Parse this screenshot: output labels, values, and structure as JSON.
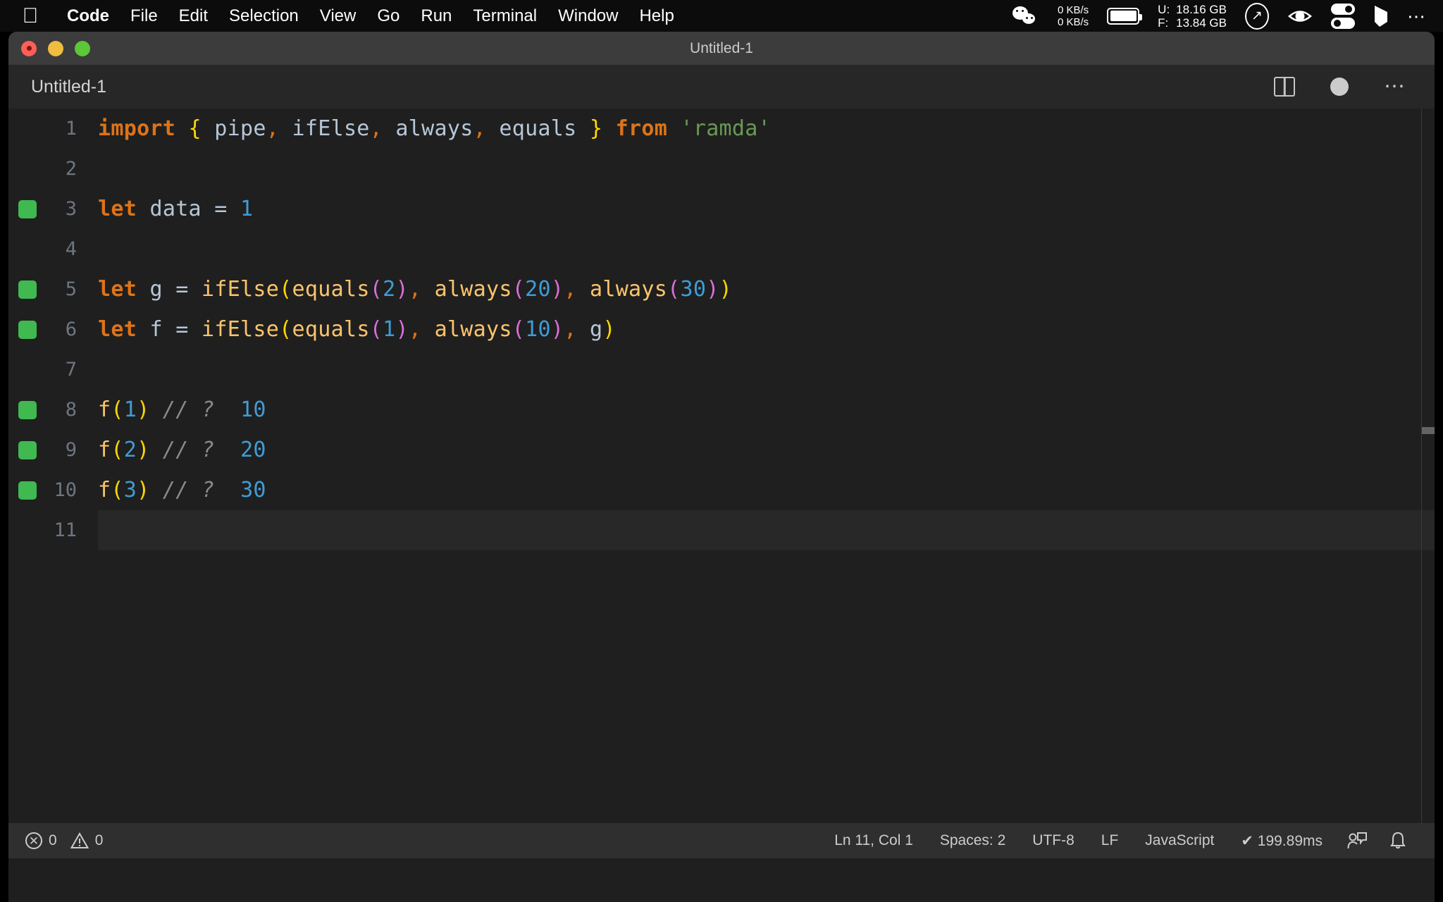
{
  "menubar": {
    "apple_icon": "apple-logo",
    "items": [
      {
        "label": "Code",
        "bold": true
      },
      {
        "label": "File",
        "bold": false
      },
      {
        "label": "Edit",
        "bold": false
      },
      {
        "label": "Selection",
        "bold": false
      },
      {
        "label": "View",
        "bold": false
      },
      {
        "label": "Go",
        "bold": false
      },
      {
        "label": "Run",
        "bold": false
      },
      {
        "label": "Terminal",
        "bold": false
      },
      {
        "label": "Window",
        "bold": false
      },
      {
        "label": "Help",
        "bold": false
      }
    ],
    "status": {
      "wechat_icon": "wechat-icon",
      "net_up": "0 KB/s",
      "net_down": "0 KB/s",
      "battery_icon": "battery-icon",
      "mem_used_key": "U:",
      "mem_free_key": "F:",
      "mem_used_value": "18.16 GB",
      "mem_free_value": "13.84 GB",
      "clock_icon": "clock-circle-icon",
      "eye_icon": "eye-icon",
      "toggles_icon": "toggle-switches-icon",
      "flag_icon": "flag-icon",
      "more_icon": "ellipsis-icon"
    }
  },
  "window": {
    "title": "Untitled-1",
    "traffic_lights": [
      "close",
      "minimize",
      "maximize"
    ]
  },
  "tabbar": {
    "tab_label": "Untitled-1",
    "actions": {
      "split_editor": "split-editor-icon",
      "unsaved_dot": "unsaved-indicator",
      "more_actions": "more-actions-icon"
    }
  },
  "editor": {
    "language": "JavaScript",
    "current_line": 11,
    "lines": [
      {
        "number": "1",
        "mark": false,
        "current": false,
        "tokens": [
          {
            "t": "import",
            "c": "t-key"
          },
          {
            "t": " ",
            "c": "t-plain"
          },
          {
            "t": "{",
            "c": "t-br1"
          },
          {
            "t": " ",
            "c": "t-plain"
          },
          {
            "t": "pipe",
            "c": "t-plain"
          },
          {
            "t": ",",
            "c": "t-punct"
          },
          {
            "t": " ",
            "c": "t-plain"
          },
          {
            "t": "ifElse",
            "c": "t-plain"
          },
          {
            "t": ",",
            "c": "t-punct"
          },
          {
            "t": " ",
            "c": "t-plain"
          },
          {
            "t": "always",
            "c": "t-plain"
          },
          {
            "t": ",",
            "c": "t-punct"
          },
          {
            "t": " ",
            "c": "t-plain"
          },
          {
            "t": "equals",
            "c": "t-plain"
          },
          {
            "t": " ",
            "c": "t-plain"
          },
          {
            "t": "}",
            "c": "t-br1"
          },
          {
            "t": " ",
            "c": "t-plain"
          },
          {
            "t": "from",
            "c": "t-key"
          },
          {
            "t": " ",
            "c": "t-plain"
          },
          {
            "t": "'ramda'",
            "c": "t-str"
          }
        ]
      },
      {
        "number": "2",
        "mark": false,
        "current": false,
        "tokens": []
      },
      {
        "number": "3",
        "mark": true,
        "current": false,
        "tokens": [
          {
            "t": "let",
            "c": "t-key"
          },
          {
            "t": " ",
            "c": "t-plain"
          },
          {
            "t": "data",
            "c": "t-plain"
          },
          {
            "t": " ",
            "c": "t-plain"
          },
          {
            "t": "=",
            "c": "t-plain"
          },
          {
            "t": " ",
            "c": "t-plain"
          },
          {
            "t": "1",
            "c": "t-num"
          }
        ]
      },
      {
        "number": "4",
        "mark": false,
        "current": false,
        "tokens": []
      },
      {
        "number": "5",
        "mark": true,
        "current": false,
        "tokens": [
          {
            "t": "let",
            "c": "t-key"
          },
          {
            "t": " ",
            "c": "t-plain"
          },
          {
            "t": "g",
            "c": "t-plain"
          },
          {
            "t": " ",
            "c": "t-plain"
          },
          {
            "t": "=",
            "c": "t-plain"
          },
          {
            "t": " ",
            "c": "t-plain"
          },
          {
            "t": "ifElse",
            "c": "t-fn"
          },
          {
            "t": "(",
            "c": "t-br1"
          },
          {
            "t": "equals",
            "c": "t-fn"
          },
          {
            "t": "(",
            "c": "t-br2"
          },
          {
            "t": "2",
            "c": "t-num"
          },
          {
            "t": ")",
            "c": "t-br2"
          },
          {
            "t": ",",
            "c": "t-punct"
          },
          {
            "t": " ",
            "c": "t-plain"
          },
          {
            "t": "always",
            "c": "t-fn"
          },
          {
            "t": "(",
            "c": "t-br2"
          },
          {
            "t": "20",
            "c": "t-num"
          },
          {
            "t": ")",
            "c": "t-br2"
          },
          {
            "t": ",",
            "c": "t-punct"
          },
          {
            "t": " ",
            "c": "t-plain"
          },
          {
            "t": "always",
            "c": "t-fn"
          },
          {
            "t": "(",
            "c": "t-br2"
          },
          {
            "t": "30",
            "c": "t-num"
          },
          {
            "t": ")",
            "c": "t-br2"
          },
          {
            "t": ")",
            "c": "t-br1"
          }
        ]
      },
      {
        "number": "6",
        "mark": true,
        "current": false,
        "tokens": [
          {
            "t": "let",
            "c": "t-key"
          },
          {
            "t": " ",
            "c": "t-plain"
          },
          {
            "t": "f",
            "c": "t-plain"
          },
          {
            "t": " ",
            "c": "t-plain"
          },
          {
            "t": "=",
            "c": "t-plain"
          },
          {
            "t": " ",
            "c": "t-plain"
          },
          {
            "t": "ifElse",
            "c": "t-fn"
          },
          {
            "t": "(",
            "c": "t-br1"
          },
          {
            "t": "equals",
            "c": "t-fn"
          },
          {
            "t": "(",
            "c": "t-br2"
          },
          {
            "t": "1",
            "c": "t-num"
          },
          {
            "t": ")",
            "c": "t-br2"
          },
          {
            "t": ",",
            "c": "t-punct"
          },
          {
            "t": " ",
            "c": "t-plain"
          },
          {
            "t": "always",
            "c": "t-fn"
          },
          {
            "t": "(",
            "c": "t-br2"
          },
          {
            "t": "10",
            "c": "t-num"
          },
          {
            "t": ")",
            "c": "t-br2"
          },
          {
            "t": ",",
            "c": "t-punct"
          },
          {
            "t": " ",
            "c": "t-plain"
          },
          {
            "t": "g",
            "c": "t-plain"
          },
          {
            "t": ")",
            "c": "t-br1"
          }
        ]
      },
      {
        "number": "7",
        "mark": false,
        "current": false,
        "tokens": []
      },
      {
        "number": "8",
        "mark": true,
        "current": false,
        "tokens": [
          {
            "t": "f",
            "c": "t-fn"
          },
          {
            "t": "(",
            "c": "t-br1"
          },
          {
            "t": "1",
            "c": "t-num"
          },
          {
            "t": ")",
            "c": "t-br1"
          },
          {
            "t": " ",
            "c": "t-plain"
          },
          {
            "t": "// ?",
            "c": "t-cmt"
          },
          {
            "t": "  ",
            "c": "t-plain"
          },
          {
            "t": "10",
            "c": "t-res"
          }
        ]
      },
      {
        "number": "9",
        "mark": true,
        "current": false,
        "tokens": [
          {
            "t": "f",
            "c": "t-fn"
          },
          {
            "t": "(",
            "c": "t-br1"
          },
          {
            "t": "2",
            "c": "t-num"
          },
          {
            "t": ")",
            "c": "t-br1"
          },
          {
            "t": " ",
            "c": "t-plain"
          },
          {
            "t": "// ?",
            "c": "t-cmt"
          },
          {
            "t": "  ",
            "c": "t-plain"
          },
          {
            "t": "20",
            "c": "t-res"
          }
        ]
      },
      {
        "number": "10",
        "mark": true,
        "current": false,
        "tokens": [
          {
            "t": "f",
            "c": "t-fn"
          },
          {
            "t": "(",
            "c": "t-br1"
          },
          {
            "t": "3",
            "c": "t-num"
          },
          {
            "t": ")",
            "c": "t-br1"
          },
          {
            "t": " ",
            "c": "t-plain"
          },
          {
            "t": "// ?",
            "c": "t-cmt"
          },
          {
            "t": "  ",
            "c": "t-plain"
          },
          {
            "t": "30",
            "c": "t-res"
          }
        ]
      },
      {
        "number": "11",
        "mark": false,
        "current": true,
        "tokens": []
      }
    ],
    "colors": {
      "background": "#1f1f1f",
      "keyword": "#dd7318",
      "string": "#6a9955",
      "number": "#3f9cd6",
      "function": "#fcc46b",
      "comment": "#8a8a8a",
      "bracket_level_1": "#ffd700",
      "bracket_level_2": "#da70d6",
      "gutter_mark": "#3fb950",
      "line_number": "#6e7681"
    }
  },
  "statusbar": {
    "error_icon": "error-icon",
    "error_count": "0",
    "warning_icon": "warning-icon",
    "warning_count": "0",
    "cursor_position": "Ln 11, Col 1",
    "indentation": "Spaces: 2",
    "encoding": "UTF-8",
    "eol": "LF",
    "language_mode": "JavaScript",
    "run_time": "✔ 199.89ms",
    "feedback_icon": "feedback-person-icon",
    "bell_icon": "notifications-bell-icon"
  }
}
